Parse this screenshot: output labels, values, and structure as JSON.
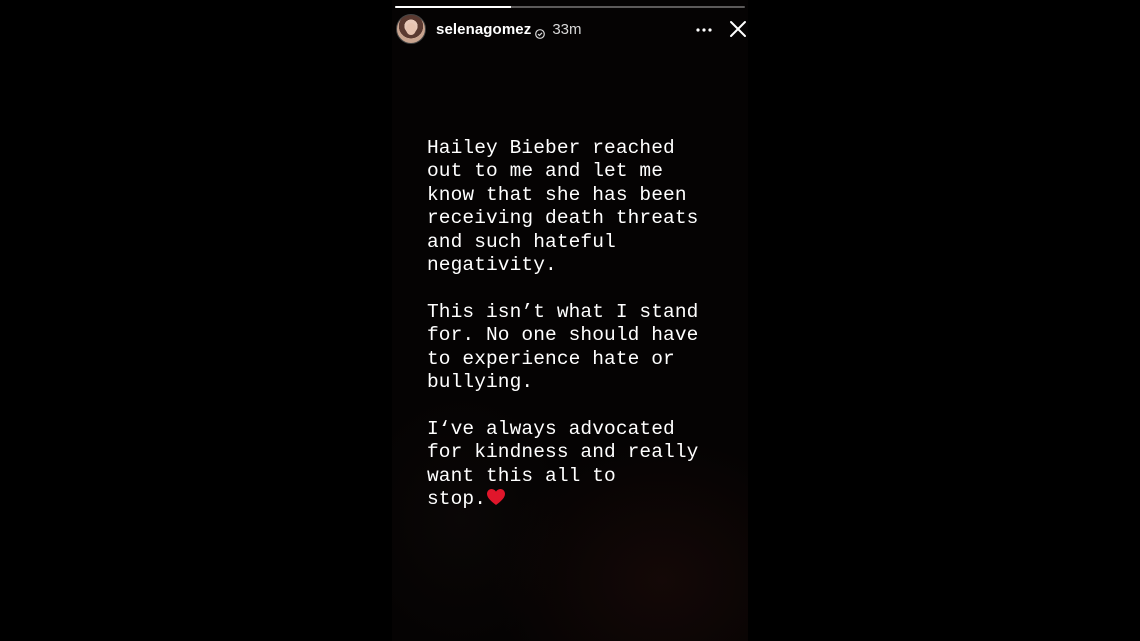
{
  "story": {
    "progress_fraction": 0.33,
    "username": "selenagomez",
    "time_ago": "33m",
    "verified_icon": "verified-badge-icon",
    "more_icon": "more-options-icon",
    "close_icon": "close-icon",
    "paragraphs": [
      "Hailey Bieber reached\nout to me and let me\nknow that she has been\nreceiving death threats\nand such hateful\nnegativity.",
      "This isn’t what I stand\nfor. No one should have\nto experience hate or\nbullying.",
      "I‘ve always advocated\nfor kindness and really\nwant this all to\nstop."
    ],
    "heart_icon": "red-heart-icon",
    "colors": {
      "text": "#ffffff",
      "heart": "#e0162b",
      "background": "#000000"
    }
  }
}
